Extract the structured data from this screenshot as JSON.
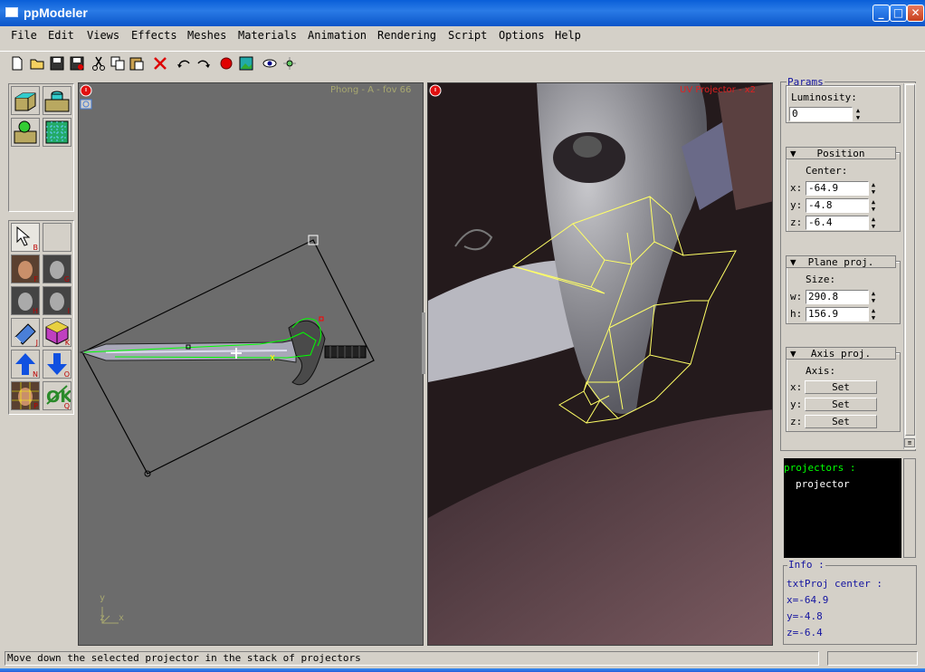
{
  "window": {
    "title": "ppModeler"
  },
  "menu": [
    "File",
    "Edit",
    "Views",
    "Effects",
    "Meshes",
    "Materials",
    "Animation",
    "Rendering",
    "Script",
    "Options",
    "Help"
  ],
  "tool_keys": [
    "B",
    "F",
    "G",
    "H",
    "I",
    "J",
    "K",
    "N",
    "O",
    "P",
    "Q"
  ],
  "viewport_left": {
    "label": "Phong - A - fov 66",
    "axis_y": "y",
    "axis_x": "x",
    "axis_z": "z"
  },
  "viewport_right": {
    "label": "UV Projector - x2"
  },
  "params": {
    "title": "Params",
    "luminosity_label": "Luminosity:",
    "luminosity_value": "0",
    "position": {
      "title": "Position",
      "center_label": "Center:",
      "x_label": "x:",
      "x_value": "-64.9",
      "y_label": "y:",
      "y_value": "-4.8",
      "z_label": "z:",
      "z_value": "-6.4"
    },
    "plane": {
      "title": "Plane proj.",
      "size_label": "Size:",
      "w_label": "w:",
      "w_value": "290.8",
      "h_label": "h:",
      "h_value": "156.9"
    },
    "axis": {
      "title": "Axis proj.",
      "axis_label": "Axis:",
      "x_label": "x:",
      "y_label": "y:",
      "z_label": "z:",
      "set_label": "Set"
    }
  },
  "projectors": {
    "header": "projectors :",
    "items": [
      "projector"
    ]
  },
  "info": {
    "title": "Info :",
    "lines": [
      "txtProj center :",
      "x=-64.9",
      "y=-4.8",
      "z=-6.4"
    ]
  },
  "status": {
    "text": "Move down the selected projector in the stack of projectors"
  },
  "colors": {
    "accent_green": "#00ff00",
    "wire_yellow": "#ffff66",
    "viewport_gray": "#6c6c6c"
  }
}
